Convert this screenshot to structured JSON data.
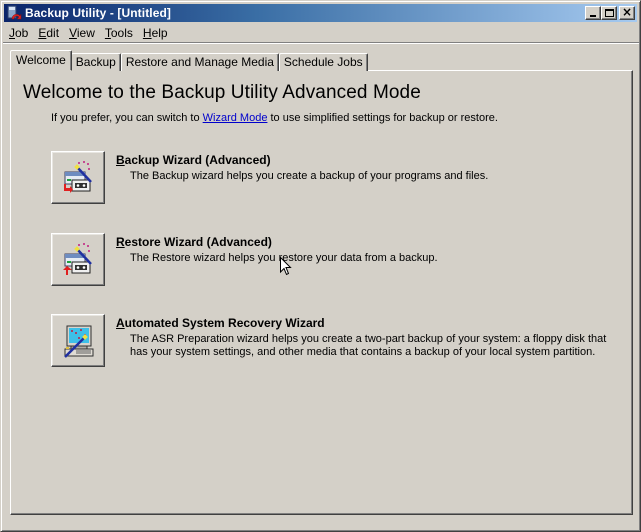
{
  "window": {
    "title": "Backup Utility - [Untitled]",
    "controls": {
      "minimize": "minimize",
      "maximize": "maximize",
      "close": "close"
    }
  },
  "menubar": {
    "items": [
      {
        "label": "Job",
        "accel": "J",
        "rest": "ob"
      },
      {
        "label": "Edit",
        "accel": "E",
        "rest": "dit"
      },
      {
        "label": "View",
        "accel": "V",
        "rest": "iew"
      },
      {
        "label": "Tools",
        "accel": "T",
        "rest": "ools"
      },
      {
        "label": "Help",
        "accel": "H",
        "rest": "elp"
      }
    ]
  },
  "tabs": [
    {
      "label": "Welcome",
      "active": true
    },
    {
      "label": "Backup",
      "active": false
    },
    {
      "label": "Restore and Manage Media",
      "active": false
    },
    {
      "label": "Schedule Jobs",
      "active": false
    }
  ],
  "welcome": {
    "heading": "Welcome to the Backup Utility Advanced Mode",
    "intro_before": "If you prefer, you can switch to ",
    "intro_link": "Wizard Mode",
    "intro_after": " to use simplified settings for backup or restore."
  },
  "wizards": [
    {
      "title_accel": "B",
      "title_rest": "ackup Wizard (Advanced)",
      "title": "Backup Wizard (Advanced)",
      "description": "The Backup wizard helps you create a backup of your programs and files.",
      "icon": "backup-wizard-icon"
    },
    {
      "title_accel": "R",
      "title_rest": "estore Wizard (Advanced)",
      "title": "Restore Wizard (Advanced)",
      "description": "The Restore wizard helps you restore your data from a backup.",
      "icon": "restore-wizard-icon"
    },
    {
      "title_accel": "A",
      "title_rest": "utomated System Recovery Wizard",
      "title": "Automated System Recovery Wizard",
      "description": "The ASR Preparation wizard helps you create a two-part backup of your system: a floppy disk that has your system settings, and other media that contains a backup of your local system partition.",
      "icon": "asr-wizard-icon"
    }
  ]
}
